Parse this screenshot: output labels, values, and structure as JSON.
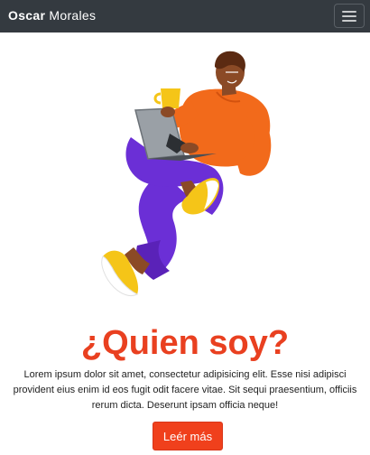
{
  "navbar": {
    "brand_first": "Oscar",
    "brand_last": "Morales",
    "toggle_icon": "hamburger-menu-icon"
  },
  "hero": {
    "illustration": "person-with-laptop-and-coffee-illustration"
  },
  "about": {
    "title": "¿Quien soy?",
    "description": "Lorem ipsum dolor sit amet, consectetur adipisicing elit. Esse nisi adipisci provident eius enim id eos fugit odit facere vitae. Sit sequi praesentium, officiis rerum dicta. Deserunt ipsam officia neque!",
    "button_label": "Leér más"
  },
  "colors": {
    "navbar_bg": "#343a40",
    "accent": "#f0401c",
    "sweater": "#f26a1b",
    "pants": "#6b2fd6",
    "shoes": "#f5c518",
    "skin": "#8b4a26"
  }
}
